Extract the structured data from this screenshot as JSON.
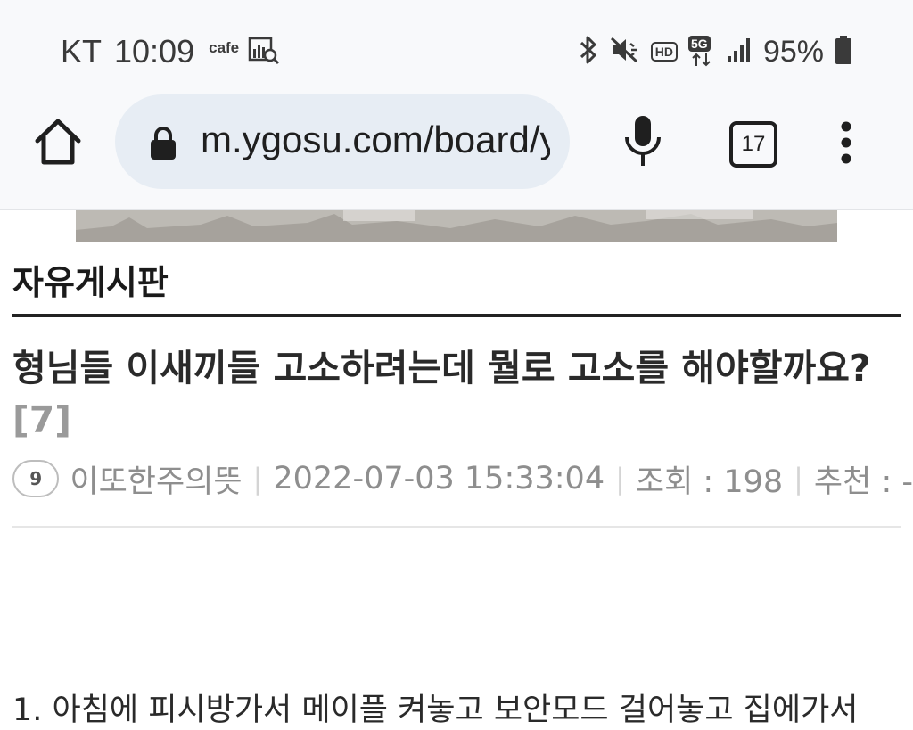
{
  "status_bar": {
    "carrier": "KT",
    "time": "10:09",
    "app_label": "cafe",
    "hd_label": "HD",
    "network_label": "5G",
    "battery": "95%"
  },
  "browser": {
    "url": "m.ygosu.com/board/yeobgi/...",
    "tab_count": "17"
  },
  "board": {
    "name": "자유게시판"
  },
  "post": {
    "title": "형님들 이새끼들 고소하려는데 뭘로 고소를 해야할까요?",
    "comment_count": "[7]",
    "author_level": "9",
    "author": "이또한주의뜻",
    "datetime": "2022-07-03 15:33:04",
    "views_label": "조회 : 198",
    "recommend_label": "추천 : -",
    "body_first_line": "1. 아침에 피시방가서 메이플 켜놓고 보안모드 걸어놓고 집에가서"
  },
  "colors": {
    "bar_bg": "#f8f9fb",
    "url_bg": "#e7edf4",
    "muted_text": "#8e8e8e",
    "rule": "#222222"
  }
}
